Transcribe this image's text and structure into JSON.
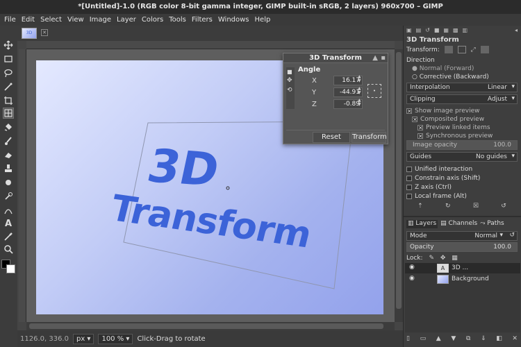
{
  "window": {
    "title": "*[Untitled]-1.0 (RGB color 8-bit gamma integer, GIMP built-in sRGB, 2 layers) 960x700 – GIMP"
  },
  "menu": [
    "File",
    "Edit",
    "Select",
    "View",
    "Image",
    "Layer",
    "Colors",
    "Tools",
    "Filters",
    "Windows",
    "Help"
  ],
  "image_tab": {
    "label": "3D"
  },
  "canvas_text": {
    "line1": "3D",
    "line2": "Transform"
  },
  "dialog": {
    "title": "3D Transform",
    "section": "Angle",
    "x_label": "X",
    "x_value": "16.17",
    "y_label": "Y",
    "y_value": "-44.91",
    "z_label": "Z",
    "z_value": "-0.89",
    "reset_label": "Reset",
    "transform_label": "Transform"
  },
  "tool_options": {
    "title": "3D Transform",
    "transform_label": "Transform:",
    "direction_label": "Direction",
    "direction_normal": "Normal (Forward)",
    "direction_corrective": "Corrective (Backward)",
    "interpolation_label": "Interpolation",
    "interpolation_value": "Linear",
    "clipping_label": "Clipping",
    "clipping_value": "Adjust",
    "show_preview": "Show image preview",
    "composited_preview": "Composited preview",
    "preview_linked": "Preview linked items",
    "synchronous_preview": "Synchronous preview",
    "image_opacity_label": "Image opacity",
    "image_opacity_value": "100.0",
    "guides_label": "Guides",
    "guides_value": "No guides",
    "unified_interaction": "Unified interaction",
    "constrain_axis": "Constrain axis (Shift)",
    "z_axis": "Z axis (Ctrl)",
    "local_frame": "Local frame (Alt)"
  },
  "layers_panel": {
    "tabs": [
      "Layers",
      "Channels",
      "Paths"
    ],
    "mode_label": "Mode",
    "mode_value": "Normal",
    "opacity_label": "Opacity",
    "opacity_value": "100.0",
    "lock_label": "Lock:",
    "layers": [
      {
        "name": "3D ..."
      },
      {
        "name": "Background"
      }
    ]
  },
  "status": {
    "coords": "1126.0, 336.0",
    "unit": "px",
    "zoom": "100 %",
    "message": "Click-Drag to rotate"
  },
  "colors": {
    "panel_bg": "#3e3e3e",
    "canvas_text": "#3c63d8",
    "gradient_start": "#e4e9ff",
    "gradient_end": "#93a2ec"
  }
}
